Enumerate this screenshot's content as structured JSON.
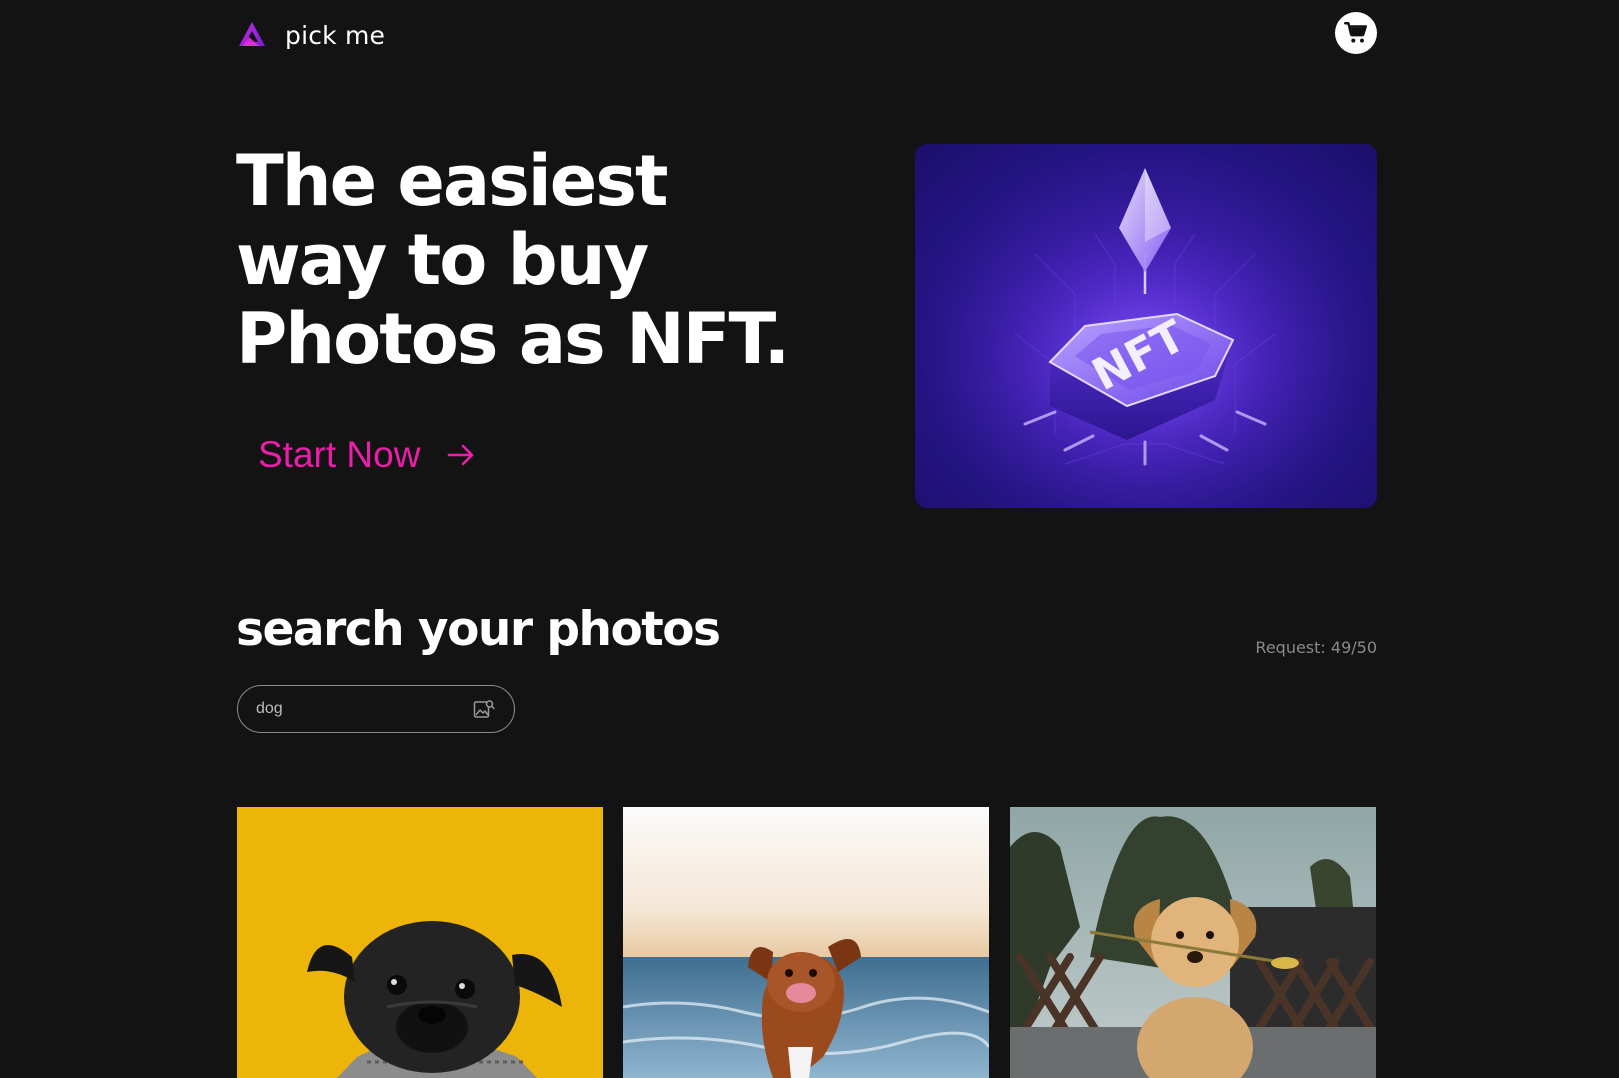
{
  "header": {
    "brand": "pick me",
    "logo_icon": "triangle-logo-icon",
    "cart_icon": "shopping-cart-icon"
  },
  "hero": {
    "heading_lines": [
      "The easiest",
      "way to buy",
      "Photos as NFT."
    ],
    "cta_label": "Start Now",
    "cta_icon": "arrow-right-icon",
    "card_label": "NFT",
    "card_illustration": "nft-token-illustration"
  },
  "search": {
    "title": "search your photos",
    "request_counter": "Request: 49/50",
    "input_value": "dog",
    "input_icon": "image-search-icon"
  },
  "photos": [
    {
      "subject": "black pug on yellow background"
    },
    {
      "subject": "brown dog running on beach"
    },
    {
      "subject": "golden retriever puppy holding flower"
    }
  ],
  "colors": {
    "background": "#131313",
    "accent": "#ea1ea8",
    "text": "#ffffff",
    "muted": "#8a8a8a"
  }
}
